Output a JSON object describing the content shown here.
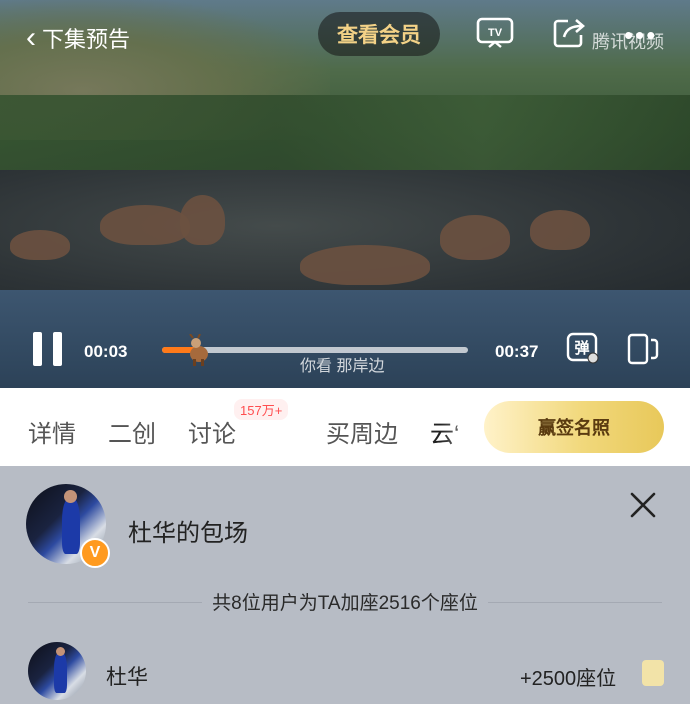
{
  "player": {
    "back_label": "下集预告",
    "vip_button": "查看会员",
    "watermark": "腾讯视频",
    "current_time": "00:03",
    "total_time": "00:37",
    "progress_fraction": 0.12,
    "subtitle": "你看 那岸边",
    "danmu_label": "弹"
  },
  "tabs": {
    "items": [
      {
        "label": "详情"
      },
      {
        "label": "二创"
      },
      {
        "label": "讨论"
      },
      {
        "label": "买周边"
      },
      {
        "label": "云‘"
      }
    ],
    "discussion_badge": "157万+",
    "action_button": "赢签名照"
  },
  "sheet": {
    "title": "杜华的包场",
    "verified_mark": "V",
    "summary": "共8位用户为TA加座2516个座位",
    "rows": [
      {
        "name": "杜华",
        "seats": "+2500座位"
      }
    ]
  },
  "colors": {
    "accent": "#ff7a1a",
    "vip_gold": "#f3d287",
    "badge_red": "#ff4d4f",
    "sheet_bg": "#b7bcc5"
  }
}
